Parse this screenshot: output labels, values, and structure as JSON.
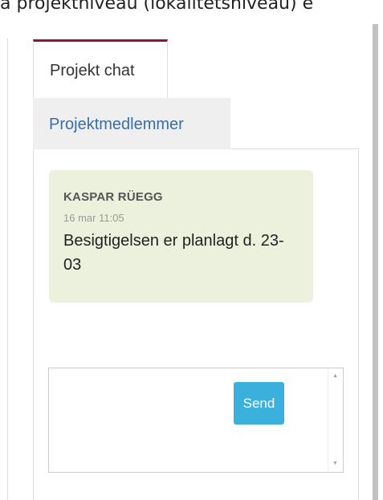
{
  "header_text": "a projektniveau (lokalitetsniveau) e",
  "tabs": {
    "chat_label": "Projekt chat",
    "members_label": "Projektmedlemmer"
  },
  "messages": [
    {
      "author": "KASPAR RÜEGG",
      "time": "16 mar 11:05",
      "text": "Besigtigelsen er planlagt d. 23-03"
    }
  ],
  "composer": {
    "value": "",
    "placeholder": "",
    "send_label": "Send"
  },
  "colors": {
    "active_tab_accent": "#8a1538",
    "link_blue": "#3a6ea8",
    "message_bg": "#ebf1dc",
    "send_button_bg": "#3bb0dc"
  }
}
